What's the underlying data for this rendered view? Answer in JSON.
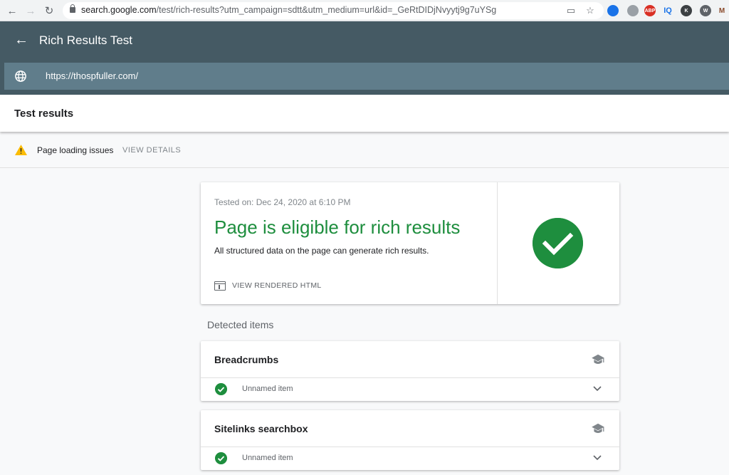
{
  "browser": {
    "url_host": "search.google.com",
    "url_path": "/test/rich-results?utm_campaign=sdtt&utm_medium=url&id=_GeRtDIDjNvyytj9g7uYSg",
    "extensions": [
      {
        "name": "chat-extension-icon",
        "label": "",
        "color": "#1a73e8"
      },
      {
        "name": "translate-extension-icon",
        "label": "",
        "color": "#9aa0a6"
      },
      {
        "name": "adblock-extension-icon",
        "label": "ABP",
        "color": "#d93025"
      },
      {
        "name": "iq-extension-icon",
        "label": "IQ",
        "color": "#1a73e8"
      },
      {
        "name": "k-extension-icon",
        "label": "K",
        "color": "#3c4043"
      },
      {
        "name": "wordpress-extension-icon",
        "label": "W",
        "color": "#5f6368"
      },
      {
        "name": "m-extension-icon",
        "label": "M",
        "color": "#8a4a2b"
      }
    ]
  },
  "header": {
    "title": "Rich Results Test",
    "url_value": "https://thospfuller.com/"
  },
  "results_bar": {
    "title": "Test results"
  },
  "warning": {
    "text": "Page loading issues",
    "link_label": "VIEW DETAILS"
  },
  "summary": {
    "tested_on": "Tested on: Dec 24, 2020 at 6:10 PM",
    "status_title": "Page is eligible for rich results",
    "status_subtitle": "All structured data on the page can generate rich results.",
    "view_html_label": "VIEW RENDERED HTML",
    "success_color": "#1e8e3e"
  },
  "detected": {
    "heading": "Detected items",
    "items": [
      {
        "title": "Breadcrumbs",
        "sub": "Unnamed item"
      },
      {
        "title": "Sitelinks searchbox",
        "sub": "Unnamed item"
      }
    ]
  },
  "colors": {
    "header_bg": "#455a64",
    "url_field_bg": "#607d8b",
    "warning": "#fbbc04"
  }
}
